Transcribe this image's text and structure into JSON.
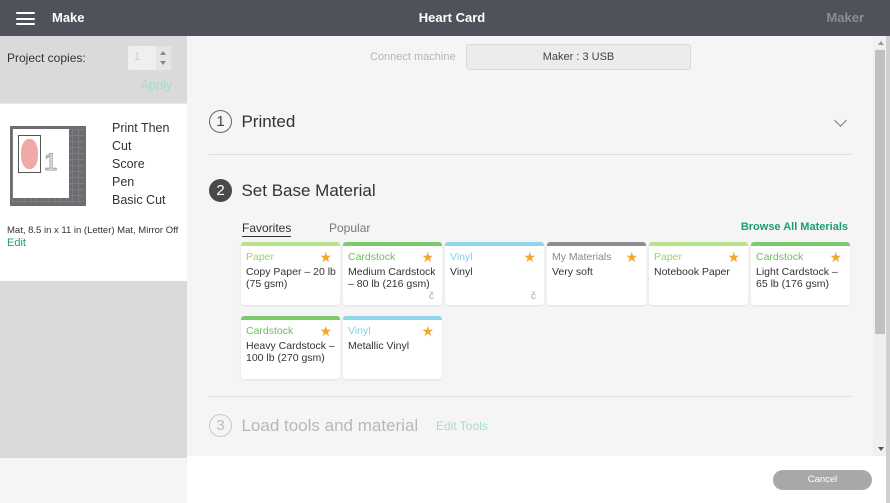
{
  "header": {
    "menu_icon": "hamburger-menu-icon",
    "section": "Make",
    "title": "Heart Card",
    "machine": "Maker"
  },
  "left_panel": {
    "copies_label": "Project copies:",
    "copies_value": "1",
    "apply_label": "Apply",
    "mat_number": "1",
    "operations": [
      "Print Then Cut",
      "Score",
      "Pen",
      "Basic Cut"
    ],
    "mat_info": "Mat, 8.5 in x 11 in (Letter) Mat, Mirror Off",
    "edit_label": "Edit"
  },
  "main": {
    "connect_label": "Connect machine",
    "machine_value": "Maker : 3 USB",
    "steps": [
      {
        "number": "1",
        "title": "Printed"
      },
      {
        "number": "2",
        "title": "Set Base Material"
      },
      {
        "number": "3",
        "title": "Load tools and material",
        "action": "Edit Tools"
      }
    ],
    "tabs": [
      {
        "label": "Favorites",
        "active": true
      },
      {
        "label": "Popular",
        "active": false
      }
    ],
    "browse_label": "Browse All Materials",
    "materials": [
      {
        "category": "Paper",
        "name": "Copy Paper – 20 lb (75 gsm)",
        "color": "#b9e28c",
        "text_color": "#9fd36a",
        "favorite": true,
        "cut_icon": false
      },
      {
        "category": "Cardstock",
        "name": "Medium Cardstock – 80 lb (216 gsm)",
        "color": "#7dc96e",
        "text_color": "#6cc05d",
        "favorite": true,
        "cut_icon": true
      },
      {
        "category": "Vinyl",
        "name": "Vinyl",
        "color": "#8fd8ec",
        "text_color": "#7fd0e8",
        "favorite": true,
        "cut_icon": true
      },
      {
        "category": "My Materials",
        "name": "Very soft",
        "color": "#8e8e8e",
        "text_color": "#8a8a8a",
        "favorite": true,
        "cut_icon": false
      },
      {
        "category": "Paper",
        "name": "Notebook Paper",
        "color": "#b9e28c",
        "text_color": "#9fd36a",
        "favorite": true,
        "cut_icon": false
      },
      {
        "category": "Cardstock",
        "name": "Light Cardstock – 65 lb (176 gsm)",
        "color": "#7dc96e",
        "text_color": "#6cc05d",
        "favorite": true,
        "cut_icon": false
      },
      {
        "category": "Cardstock",
        "name": "Heavy Cardstock – 100 lb (270 gsm)",
        "color": "#7dc96e",
        "text_color": "#6cc05d",
        "favorite": true,
        "cut_icon": false
      },
      {
        "category": "Vinyl",
        "name": "Metallic Vinyl",
        "color": "#8fd8ec",
        "text_color": "#7fd0e8",
        "favorite": true,
        "cut_icon": false
      }
    ],
    "star_glyph": "★",
    "cut_glyph": "č"
  },
  "footer": {
    "cancel_label": "Cancel"
  },
  "colors": {
    "header_bg": "#4f525a",
    "accent_green": "#1c9e74",
    "star": "#f6a623"
  }
}
